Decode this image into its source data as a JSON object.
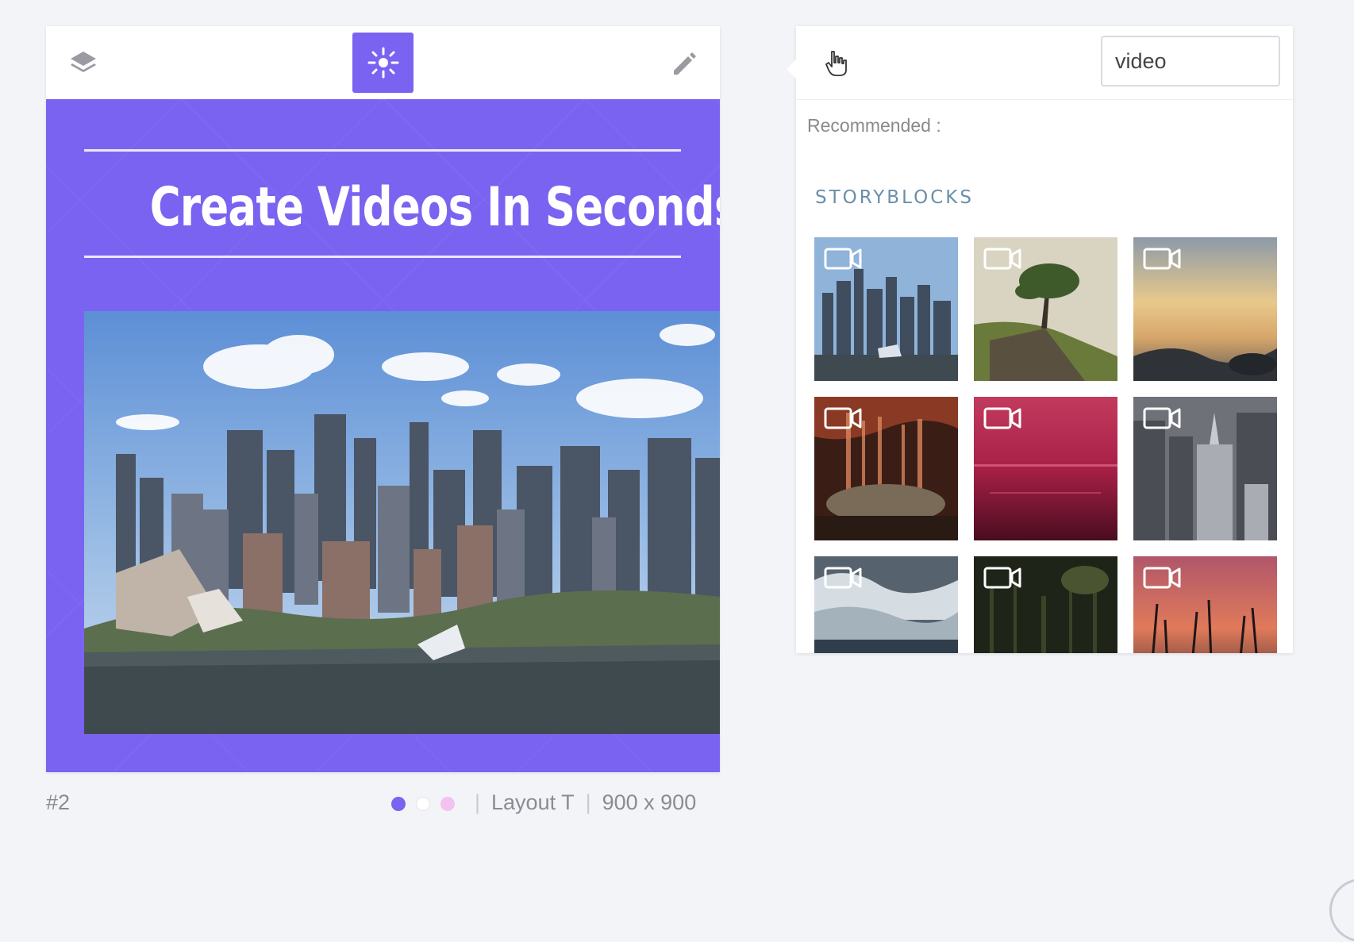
{
  "editor": {
    "toolbar": {
      "layers_icon": "layers-icon",
      "effects_icon": "sparkle-icon",
      "edit_icon": "pencil-icon",
      "active_color": "#7b63f1"
    },
    "canvas": {
      "background_color": "#7b63f1",
      "headline": "Create Videos In Seconds"
    },
    "footer": {
      "slide_number": "#2",
      "swatches": [
        "#7b63f1",
        "#ffffff",
        "#f3c2ef"
      ],
      "layout": "Layout T",
      "dimensions": "900 x 900",
      "separator": "|"
    }
  },
  "media_panel": {
    "cursor_icon": "hand-pointer-icon",
    "search": {
      "value": "video",
      "placeholder": ""
    },
    "recommended_label": "Recommended :",
    "provider_label": "STORYBLOCKS",
    "tiles": [
      {
        "theme": "city-skyline",
        "icon": "video-camera-icon"
      },
      {
        "theme": "lone-tree",
        "icon": "video-camera-icon"
      },
      {
        "theme": "sunset-shore",
        "icon": "video-camera-icon"
      },
      {
        "theme": "fire-waterfall",
        "icon": "video-camera-icon"
      },
      {
        "theme": "red-water",
        "icon": "video-camera-icon"
      },
      {
        "theme": "aerial-buildings",
        "icon": "video-camera-icon"
      },
      {
        "theme": "ocean-waves",
        "icon": "video-camera-icon"
      },
      {
        "theme": "dark-forest",
        "icon": "video-camera-icon"
      },
      {
        "theme": "reeds-sunset",
        "icon": "video-camera-icon"
      }
    ]
  }
}
